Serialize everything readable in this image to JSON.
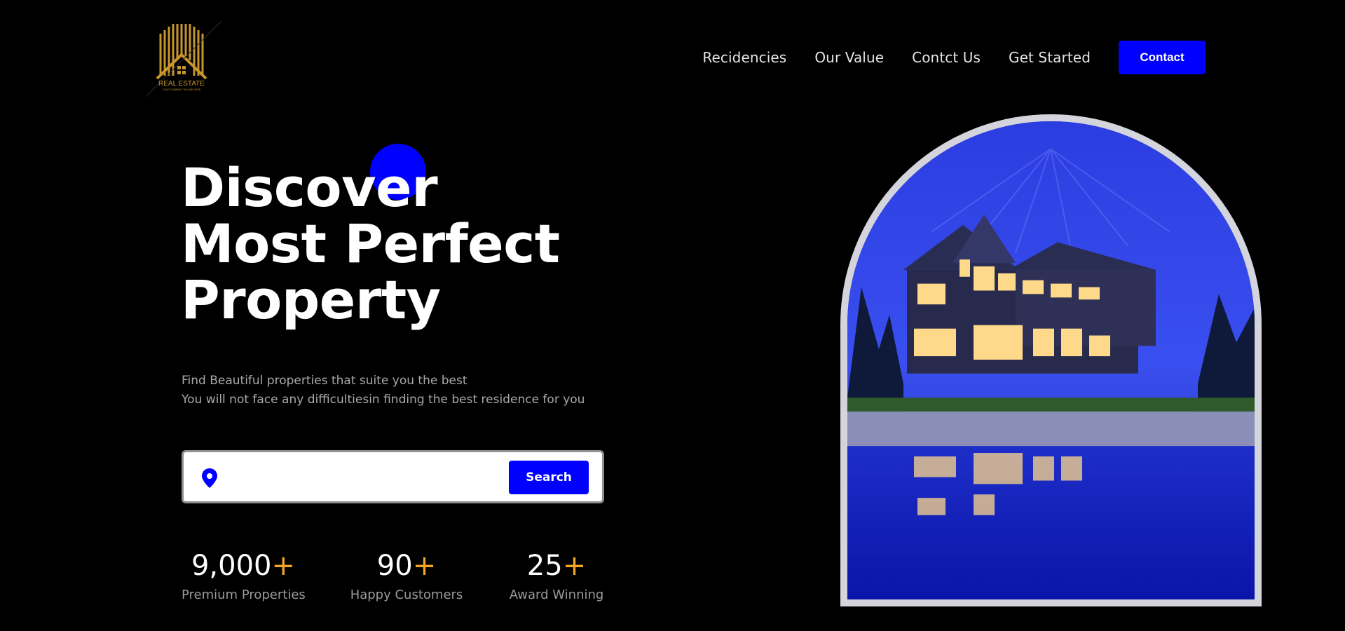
{
  "logo": {
    "brand_text": "REAL ESTATE",
    "tagline": "YOUR COMPANY TAGLINE HERE",
    "color": "#c9962c"
  },
  "nav": {
    "items": [
      {
        "label": "Recidencies"
      },
      {
        "label": "Our Value"
      },
      {
        "label": "Contct Us"
      },
      {
        "label": "Get Started"
      }
    ],
    "contact_label": "Contact"
  },
  "hero": {
    "title_lines": [
      "Discover",
      "Most Perfect",
      "Property"
    ],
    "subtitle_lines": [
      "Find Beautiful properties that suite you the best",
      "You will not face any difficultiesin finding the best residence for you"
    ]
  },
  "search": {
    "value": "",
    "placeholder": "",
    "button_label": "Search",
    "icon": "location-pin-icon"
  },
  "stats": [
    {
      "value": "9,000",
      "suffix": "+",
      "label": "Premium Properties"
    },
    {
      "value": "90",
      "suffix": "+",
      "label": "Happy Customers"
    },
    {
      "value": "25",
      "suffix": "+",
      "label": "Award Winning"
    }
  ],
  "colors": {
    "accent": "#0000ff",
    "stat_plus": "#f5a623",
    "background": "#000000",
    "arch_border": "#d4d4dc"
  },
  "hero_image": {
    "subject": "modern house with lit windows beside a pool at dusk"
  }
}
